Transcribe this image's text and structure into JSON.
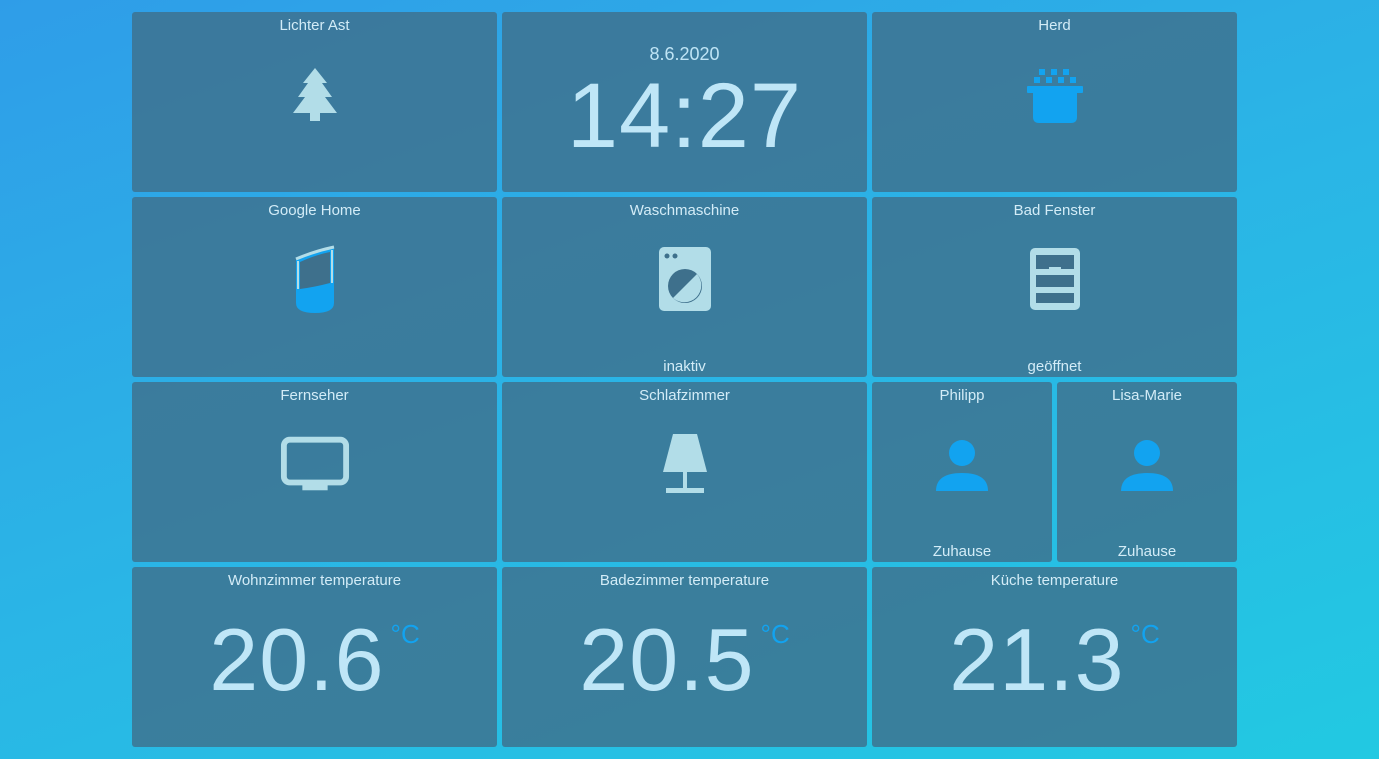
{
  "colors": {
    "accent_active": "#12a3f0",
    "icon_inactive": "#b2dde8",
    "tile_bg": "#3e708c"
  },
  "tiles": {
    "tree": {
      "title": "Lichter Ast",
      "icon": "pine-tree-icon"
    },
    "clock": {
      "date": "8.6.2020",
      "time": "14:27"
    },
    "stove": {
      "title": "Herd",
      "icon": "cooking-pot-icon"
    },
    "google_home": {
      "title": "Google Home",
      "icon": "smart-speaker-icon"
    },
    "washer": {
      "title": "Waschmaschine",
      "state": "inaktiv",
      "icon": "washing-machine-icon"
    },
    "bath_window": {
      "title": "Bad Fenster",
      "state": "geöffnet",
      "icon": "window-icon"
    },
    "tv": {
      "title": "Fernseher",
      "icon": "tv-icon"
    },
    "bedroom": {
      "title": "Schlafzimmer",
      "icon": "lamp-icon"
    },
    "philipp": {
      "title": "Philipp",
      "state": "Zuhause",
      "icon": "person-icon"
    },
    "lisa": {
      "title": "Lisa-Marie",
      "state": "Zuhause",
      "icon": "person-icon"
    },
    "temp_living": {
      "title": "Wohnzimmer temperature",
      "value": "20.6",
      "unit": "°C"
    },
    "temp_bath": {
      "title": "Badezimmer temperature",
      "value": "20.5",
      "unit": "°C"
    },
    "temp_kitchen": {
      "title": "Küche temperature",
      "value": "21.3",
      "unit": "°C"
    }
  }
}
